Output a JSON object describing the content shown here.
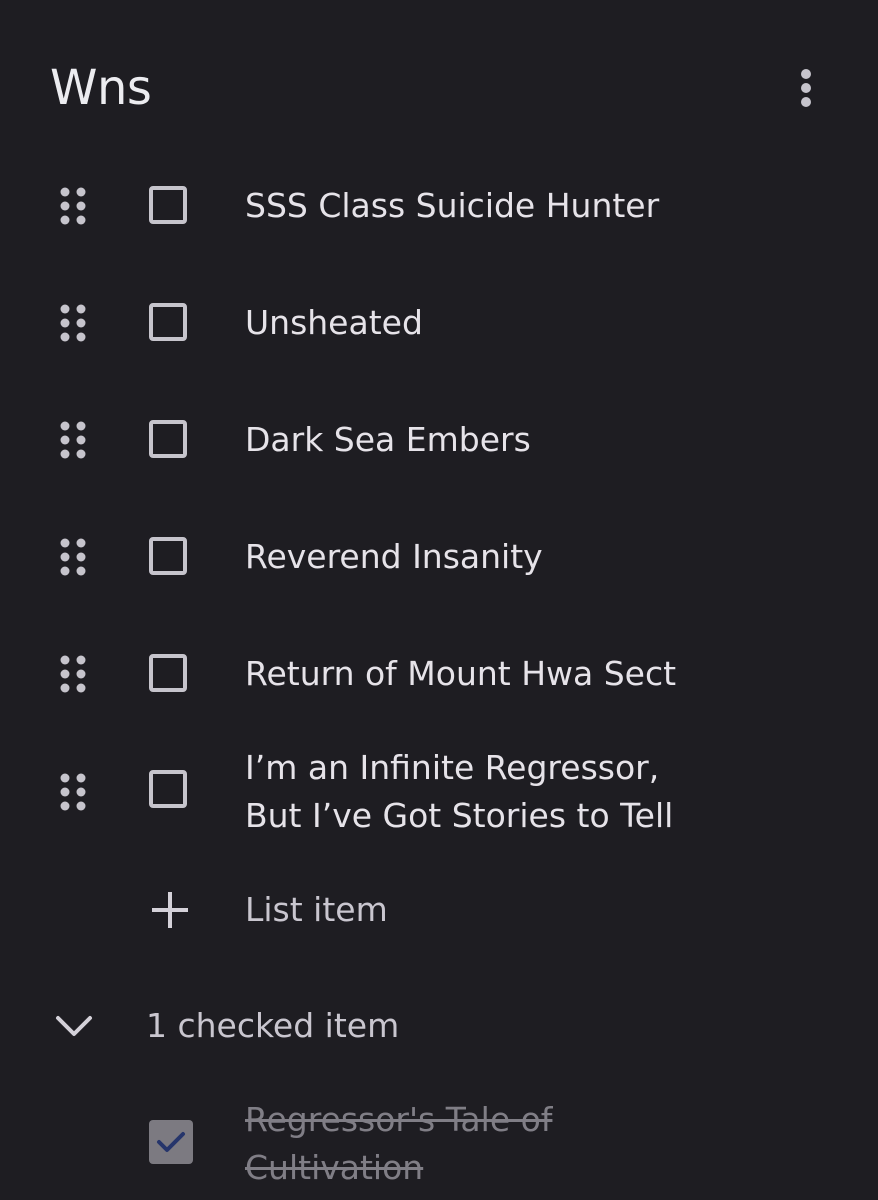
{
  "note": {
    "title": "Wns",
    "menu_icon": "more-vert-icon"
  },
  "items": [
    {
      "text": "SSS Class Suicide Hunter",
      "checked": false
    },
    {
      "text": "Unsheated",
      "checked": false
    },
    {
      "text": "Dark Sea Embers",
      "checked": false
    },
    {
      "text": "Reverend Insanity",
      "checked": false
    },
    {
      "text": "Return of Mount Hwa Sect",
      "checked": false
    },
    {
      "text_line1": "I’m an Infinite Regressor,",
      "text_line2": "But I’ve Got Stories to Tell",
      "checked": false
    }
  ],
  "add_item": {
    "label": "List item",
    "icon": "plus-icon"
  },
  "checked_section": {
    "label": "1 checked item",
    "icon": "chevron-down-icon",
    "items": [
      {
        "text_line1": "Regressor's Tale of",
        "text_line2": "Cultivation",
        "checked": true
      }
    ]
  },
  "colors": {
    "background": "#1e1d22",
    "text": "#e6e3e9",
    "muted": "#807e86",
    "check_mark": "#2d4aa8"
  }
}
